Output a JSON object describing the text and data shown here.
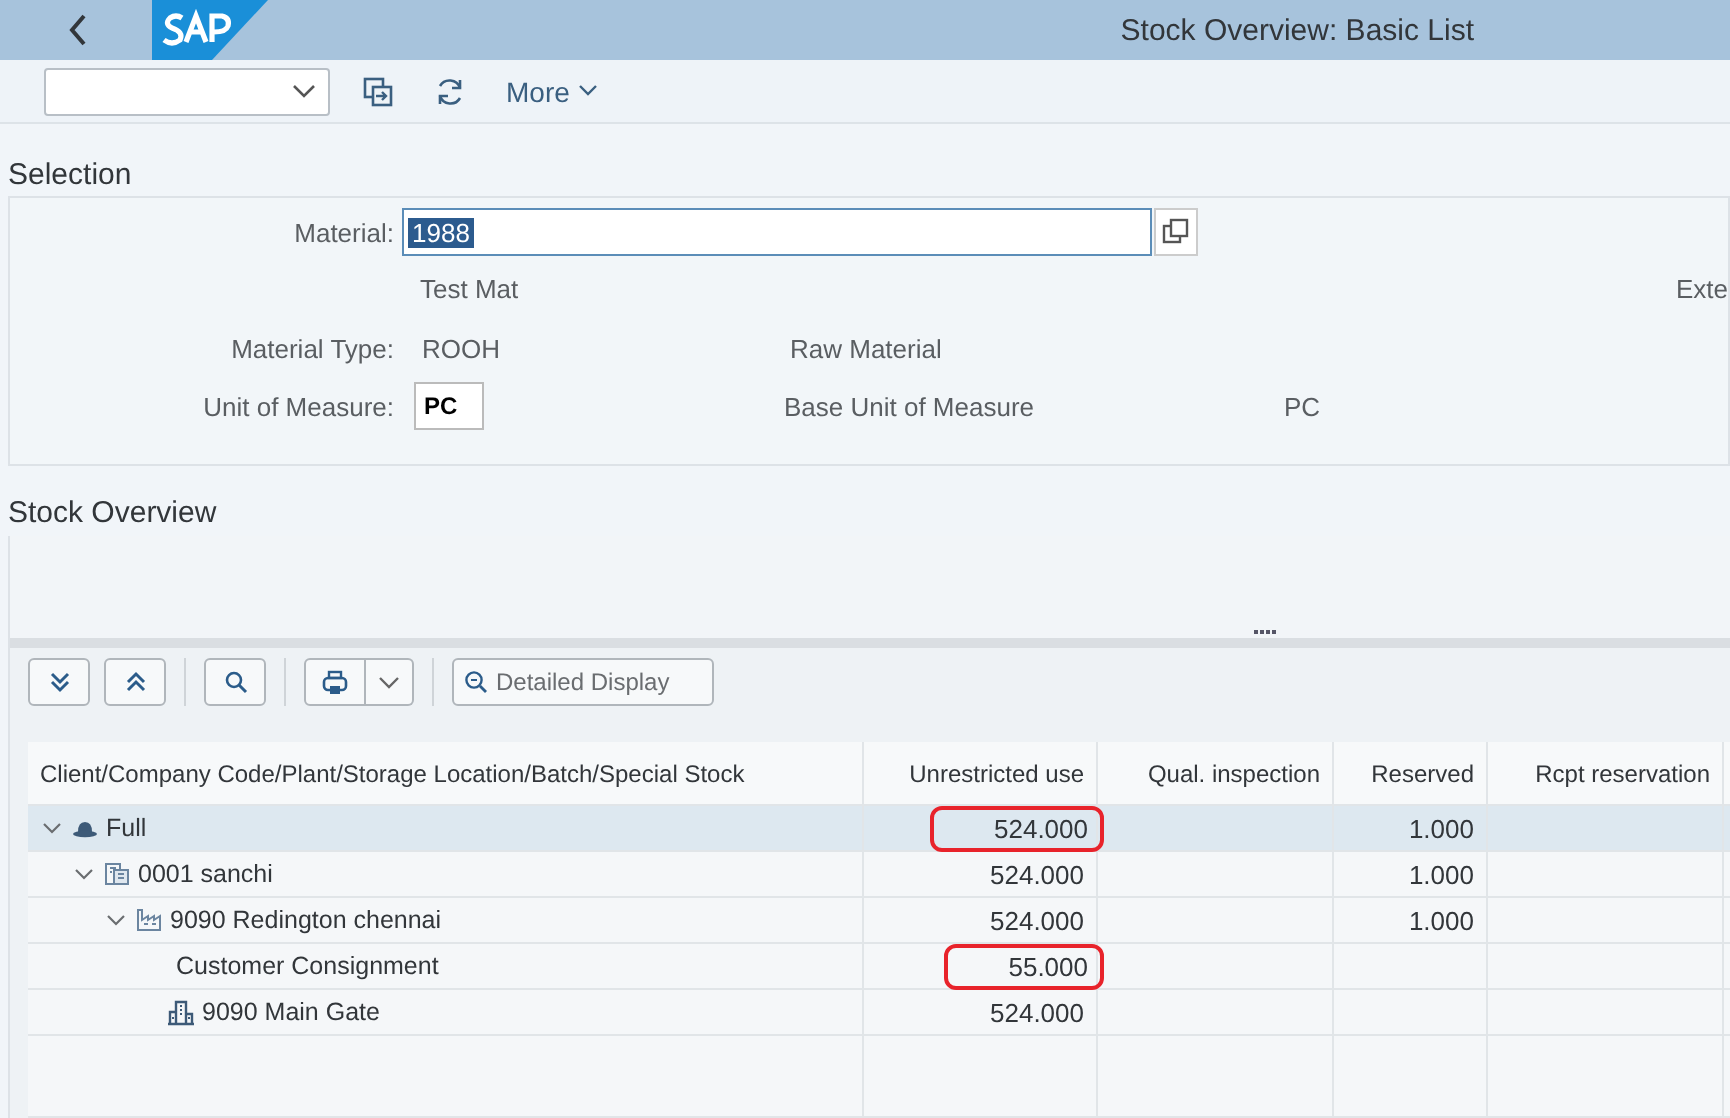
{
  "shell": {
    "title": "Stock Overview: Basic List"
  },
  "toolbar": {
    "more": "More"
  },
  "selection": {
    "title": "Selection",
    "material_label": "Material:",
    "material": "1988",
    "material_text": "Test Mat",
    "cut_text": "Exte",
    "material_type_label": "Material Type:",
    "material_type": "ROOH",
    "material_type_text": "Raw Material",
    "uom_label": "Unit of Measure:",
    "uom": "PC",
    "base_uom_label": "Base Unit of Measure",
    "base_uom": "PC"
  },
  "stock_overview": {
    "title": "Stock Overview",
    "detail_button": "Detailed Display",
    "columns": [
      "Client/Company Code/Plant/Storage Location/Batch/Special Stock",
      "Unrestricted use",
      "Qual. inspection",
      "Reserved",
      "Rcpt reservation"
    ],
    "rows": [
      {
        "kind": "client",
        "expanded": true,
        "selected": true,
        "cells": [
          {
            "text": "Full"
          },
          {
            "text": "524.000",
            "circled": true
          },
          {},
          {
            "text": "1.000"
          },
          {}
        ],
        "children": [
          {
            "kind": "company",
            "expanded": true,
            "selected": false,
            "cells": [
              {
                "text": "0001 sanchi"
              },
              {
                "text": "524.000"
              },
              {},
              {
                "text": "1.000"
              },
              {}
            ],
            "children": [
              {
                "kind": "plant",
                "expanded": true,
                "selected": false,
                "cells": [
                  {
                    "text": "9090 Redington chennai"
                  },
                  {
                    "text": "524.000"
                  },
                  {},
                  {
                    "text": "1.000"
                  },
                  {}
                ],
                "children": [
                  {
                    "kind": "special",
                    "selected": false,
                    "cells": [
                      {
                        "text": "Customer Consignment"
                      },
                      {
                        "text": "55.000",
                        "circled": true
                      },
                      {},
                      {},
                      {}
                    ]
                  },
                  {
                    "kind": "storage",
                    "selected": false,
                    "cells": [
                      {
                        "text": "9090 Main Gate"
                      },
                      {
                        "text": "524.000"
                      },
                      {},
                      {},
                      {}
                    ]
                  }
                ]
              }
            ]
          }
        ]
      }
    ]
  }
}
